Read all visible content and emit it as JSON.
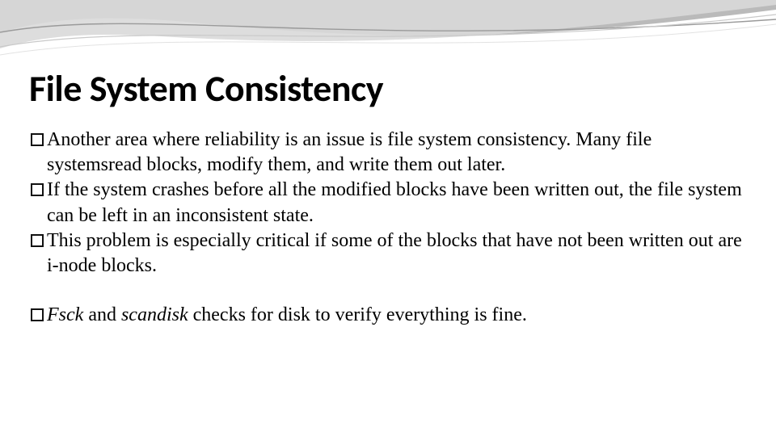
{
  "title": "File System Consistency",
  "bullets": [
    {
      "text": "Another area where reliability is an issue is file system consistency. Many file systemsread blocks, modify them, and write them out later."
    },
    {
      "text": "If the system crashes before all the modified blocks have been written out, the file system can be left in an inconsistent state."
    },
    {
      "text": "This problem is especially critical if some of the blocks that have not been written out are i-node blocks."
    }
  ],
  "closing_prefix_italic": "Fsck",
  "closing_mid": " and ",
  "closing_mid_italic": "scandisk",
  "closing_end": " checks for disk to verify everything is fine."
}
